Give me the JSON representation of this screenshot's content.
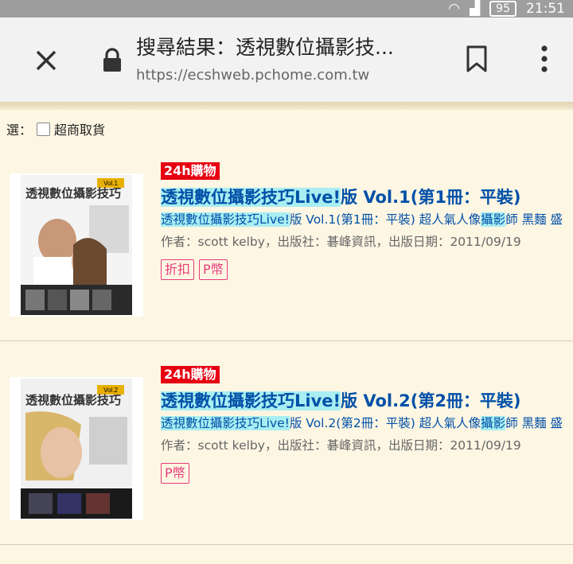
{
  "status_bar": {
    "battery": "95",
    "time": "21:51"
  },
  "browser": {
    "title": "搜尋結果：透視數位攝影技...",
    "url": "https://ecshweb.pchome.com.tw"
  },
  "filter": {
    "prefix": "選：",
    "checkbox_label": "超商取貨"
  },
  "products": [
    {
      "badge": "24h購物",
      "title_hl": "透視數位攝影技巧Live!",
      "title_rest": "版 Vol.1(第1冊：平裝)",
      "desc_hl": "透視數位攝影技巧Live!",
      "desc_mid": "版 Vol.1(第1冊：平裝) 超人氣人像",
      "desc_hl2": "攝影",
      "desc_rest": "師 黑麵 盛",
      "meta": "作者：scott kelby，出版社：碁峰資訊，出版日期：2011/09/19",
      "tags": [
        "折扣",
        "P幣"
      ],
      "cover_title": "透視數位攝影技巧",
      "cover_badge": "Vol.1"
    },
    {
      "badge": "24h購物",
      "title_hl": "透視數位攝影技巧Live!",
      "title_rest": "版 Vol.2(第2冊：平裝)",
      "desc_hl": "透視數位攝影技巧Live!",
      "desc_mid": "版 Vol.2(第2冊：平裝) 超人氣人像",
      "desc_hl2": "攝影",
      "desc_rest": "師 黑麵 盛",
      "meta": "作者：scott kelby，出版社：碁峰資訊，出版日期：2011/09/19",
      "tags": [
        "P幣"
      ],
      "cover_title": "透視數位攝影技巧",
      "cover_badge": "Vol.2"
    }
  ],
  "colors": {
    "accent": "#0050a8",
    "highlight": "#a8eef2",
    "badge": "#e60012",
    "tag": "#e63c7a"
  },
  "icons": [
    "close-icon",
    "lock-icon",
    "bookmark-icon",
    "more-vert-icon",
    "wifi-icon",
    "signal-icon",
    "battery-icon"
  ]
}
